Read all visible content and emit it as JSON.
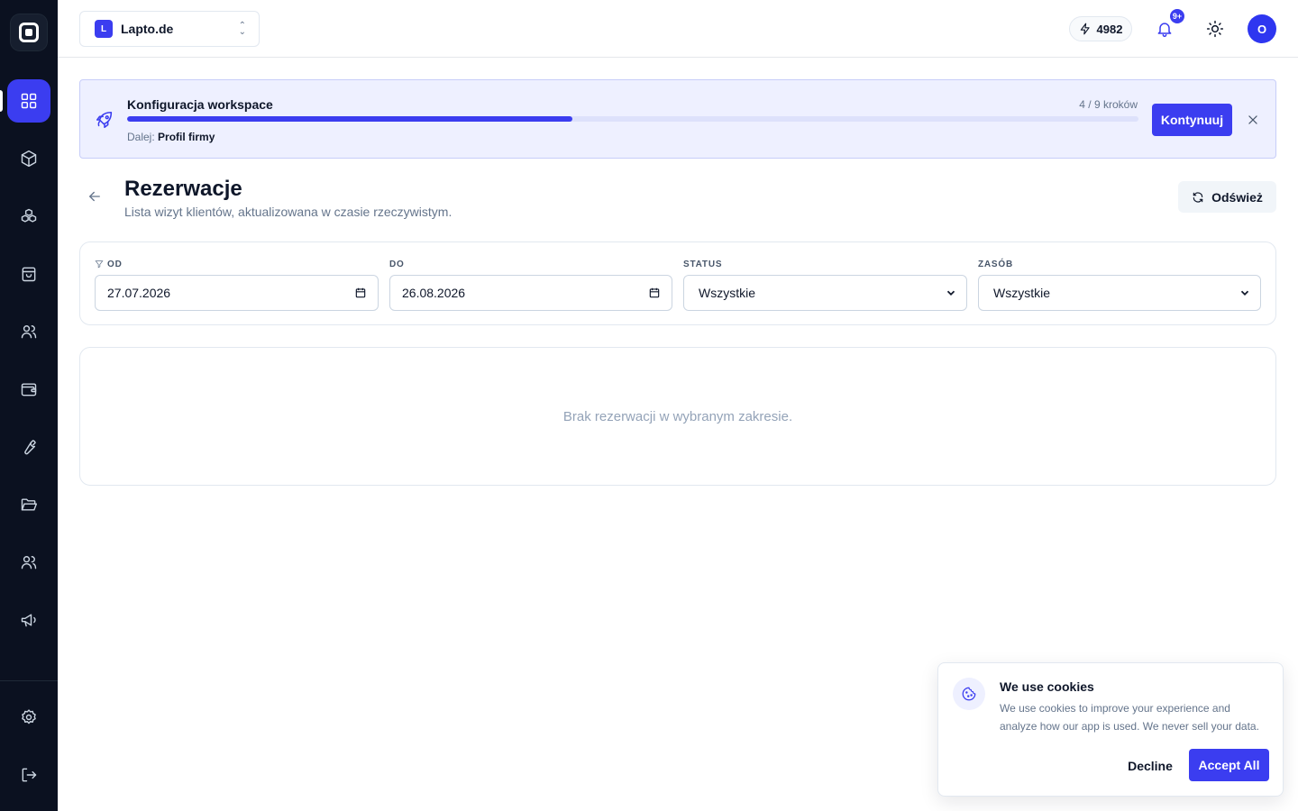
{
  "workspace": {
    "badge": "L",
    "name": "Lapto.de"
  },
  "topbar": {
    "credits": "4982",
    "notifications_badge": "9+",
    "avatar_initial": "O"
  },
  "sidebar": {
    "items": [
      {
        "name": "dashboard",
        "icon": "layout-grid-icon",
        "active": true
      },
      {
        "name": "products",
        "icon": "package-icon"
      },
      {
        "name": "components",
        "icon": "boxes-icon"
      },
      {
        "name": "shop",
        "icon": "shopping-bag-icon"
      },
      {
        "name": "customers",
        "icon": "users-icon"
      },
      {
        "name": "wallet",
        "icon": "wallet-icon"
      },
      {
        "name": "tools",
        "icon": "wrench-icon"
      },
      {
        "name": "files",
        "icon": "folder-open-icon"
      },
      {
        "name": "team",
        "icon": "users-icon"
      },
      {
        "name": "marketing",
        "icon": "megaphone-icon"
      },
      {
        "name": "settings",
        "icon": "settings-icon"
      },
      {
        "name": "logout",
        "icon": "log-out-icon"
      }
    ]
  },
  "onboarding": {
    "title": "Konfiguracja workspace",
    "steps": "4 / 9 kroków",
    "progress": 0.44,
    "next_prefix": "Dalej:",
    "next_step": "Profil firmy",
    "continue_label": "Kontynuuj"
  },
  "page": {
    "title": "Rezerwacje",
    "subtitle": "Lista wizyt klientów, aktualizowana w czasie rzeczywistym.",
    "refresh_label": "Odśwież"
  },
  "filters": {
    "from_label": "OD",
    "from_value": "27.07.2026",
    "to_label": "DO",
    "to_value": "26.08.2026",
    "status_label": "STATUS",
    "status_value": "Wszystkie",
    "resource_label": "ZASÓB",
    "resource_value": "Wszystkie"
  },
  "empty_state": {
    "text": "Brak rezerwacji w wybranym zakresie."
  },
  "cookies": {
    "title": "We use cookies",
    "text": "We use cookies to improve your experience and analyze how our app is used. We never sell your data.",
    "decline_label": "Decline",
    "accept_label": "Accept All"
  },
  "colors": {
    "accent": "#3b3df0",
    "sidebar_bg": "#0b1120",
    "banner_bg": "#eef0ff"
  }
}
